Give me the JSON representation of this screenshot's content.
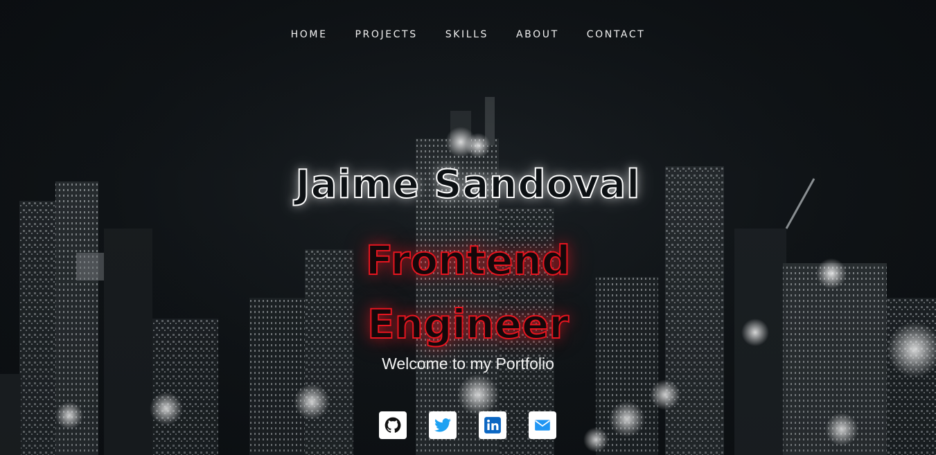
{
  "nav": {
    "items": [
      {
        "label": "HOME"
      },
      {
        "label": "PROJECTS"
      },
      {
        "label": "SKILLS"
      },
      {
        "label": "ABOUT"
      },
      {
        "label": "CONTACT"
      }
    ]
  },
  "hero": {
    "name": "Jaime Sandoval",
    "role_line1": "Frontend",
    "role_line2": "Engineer",
    "welcome": "Welcome to my Portfolio"
  },
  "socials": [
    {
      "icon": "github-icon"
    },
    {
      "icon": "twitter-icon"
    },
    {
      "icon": "linkedin-icon"
    },
    {
      "icon": "email-icon"
    }
  ],
  "colors": {
    "accent_red": "#e6151f",
    "name_glow": "#ffffff",
    "twitter_blue": "#1da1f2",
    "linkedin_blue": "#0a66c2",
    "email_blue": "#2196f3"
  }
}
